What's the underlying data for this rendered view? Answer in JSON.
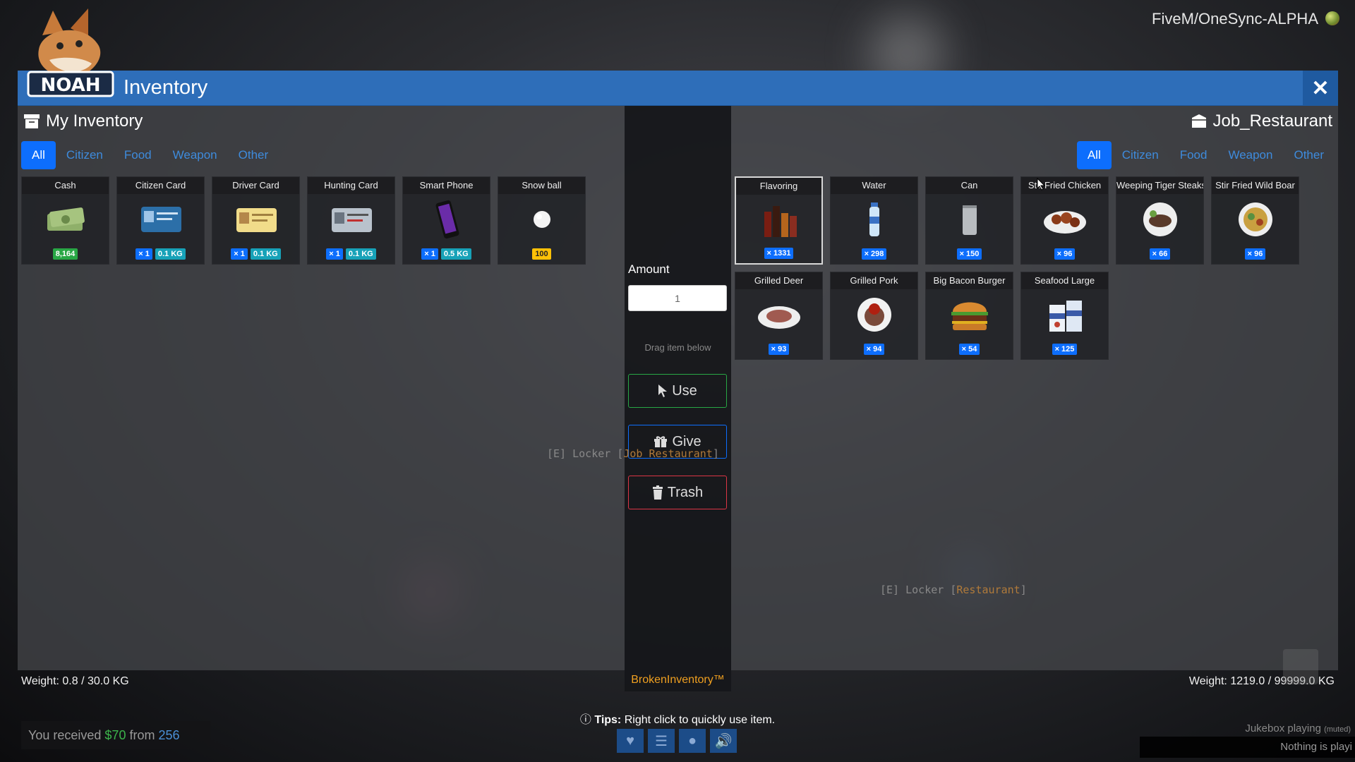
{
  "server": {
    "name": "FiveM/OneSync-ALPHA"
  },
  "window": {
    "title": "Inventory",
    "close_icon": "close-icon"
  },
  "left": {
    "title": "My Inventory",
    "tabs": [
      "All",
      "Citizen",
      "Food",
      "Weapon",
      "Other"
    ],
    "active_tab": "All",
    "items": [
      {
        "name": "Cash",
        "icon": "cash-icon",
        "badges": [
          {
            "text": "8,164",
            "style": "green"
          }
        ]
      },
      {
        "name": "Citizen Card",
        "icon": "id-card-icon",
        "badges": [
          {
            "text": "× 1",
            "style": "blue"
          },
          {
            "text": "0.1 KG",
            "style": "teal"
          }
        ]
      },
      {
        "name": "Driver Card",
        "icon": "driver-card-icon",
        "badges": [
          {
            "text": "× 1",
            "style": "blue"
          },
          {
            "text": "0.1 KG",
            "style": "teal"
          }
        ]
      },
      {
        "name": "Hunting Card",
        "icon": "hunting-card-icon",
        "badges": [
          {
            "text": "× 1",
            "style": "blue"
          },
          {
            "text": "0.1 KG",
            "style": "teal"
          }
        ]
      },
      {
        "name": "Smart Phone",
        "icon": "phone-icon",
        "badges": [
          {
            "text": "× 1",
            "style": "blue"
          },
          {
            "text": "0.5 KG",
            "style": "teal"
          }
        ]
      },
      {
        "name": "Snow ball",
        "icon": "snowball-icon",
        "badges": [
          {
            "text": "100",
            "style": "yellow"
          }
        ]
      }
    ],
    "weight": "Weight: 0.8 / 30.0 KG"
  },
  "right": {
    "title": "Job_Restaurant",
    "tabs": [
      "All",
      "Citizen",
      "Food",
      "Weapon",
      "Other"
    ],
    "active_tab": "All",
    "items": [
      {
        "name": "Flavoring",
        "icon": "sauce-bottles-icon",
        "badges": [
          {
            "text": "× 1331",
            "style": "blue"
          }
        ],
        "selected": true
      },
      {
        "name": "Water",
        "icon": "water-bottle-icon",
        "badges": [
          {
            "text": "× 298",
            "style": "blue"
          }
        ]
      },
      {
        "name": "Can",
        "icon": "can-icon",
        "badges": [
          {
            "text": "× 150",
            "style": "blue"
          }
        ]
      },
      {
        "name": "Stir Fried Chicken",
        "icon": "chicken-dish-icon",
        "badges": [
          {
            "text": "× 96",
            "style": "blue"
          }
        ]
      },
      {
        "name": "Weeping Tiger Steaks",
        "icon": "steak-dish-icon",
        "badges": [
          {
            "text": "× 66",
            "style": "blue"
          }
        ]
      },
      {
        "name": "Stir Fried Wild Boar",
        "icon": "boar-dish-icon",
        "badges": [
          {
            "text": "× 96",
            "style": "blue"
          }
        ]
      },
      {
        "name": "Grilled Deer",
        "icon": "deer-dish-icon",
        "badges": [
          {
            "text": "× 93",
            "style": "blue"
          }
        ]
      },
      {
        "name": "Grilled Pork",
        "icon": "pork-dish-icon",
        "badges": [
          {
            "text": "× 94",
            "style": "blue"
          }
        ]
      },
      {
        "name": "Big Bacon Burger",
        "icon": "burger-icon",
        "badges": [
          {
            "text": "× 54",
            "style": "blue"
          }
        ]
      },
      {
        "name": "Seafood Large",
        "icon": "seafood-box-icon",
        "badges": [
          {
            "text": "× 125",
            "style": "blue"
          }
        ]
      }
    ],
    "weight": "Weight: 1219.0 / 99999.0 KG"
  },
  "middle": {
    "amount_label": "Amount",
    "amount_value": "1",
    "drag_hint": "Drag item below",
    "use_label": "Use",
    "give_label": "Give",
    "trash_label": "Trash",
    "brand": "BrokenInventory™"
  },
  "world": {
    "locker1_prefix": "[E] Locker [",
    "locker1_name": "Job Restaurant",
    "locker1_suffix": "]",
    "locker2_prefix": "[E] Locker [",
    "locker2_name": "Restaurant",
    "locker2_suffix": "]"
  },
  "tips": {
    "label": "Tips:",
    "text": " Right click to quickly use item."
  },
  "notification": {
    "prefix": "You received ",
    "amount": "$70",
    "middle": " from ",
    "player": "256"
  },
  "jukebox": {
    "status": "Jukebox playing ",
    "muted": "(muted)",
    "now_playing": "Nothing is playi"
  },
  "colors": {
    "accent": "#2e6eb9",
    "tab_active": "#0d6efd",
    "use": "#28a745",
    "give": "#0d6efd",
    "trash": "#dc3545",
    "brand": "#f0a020"
  }
}
